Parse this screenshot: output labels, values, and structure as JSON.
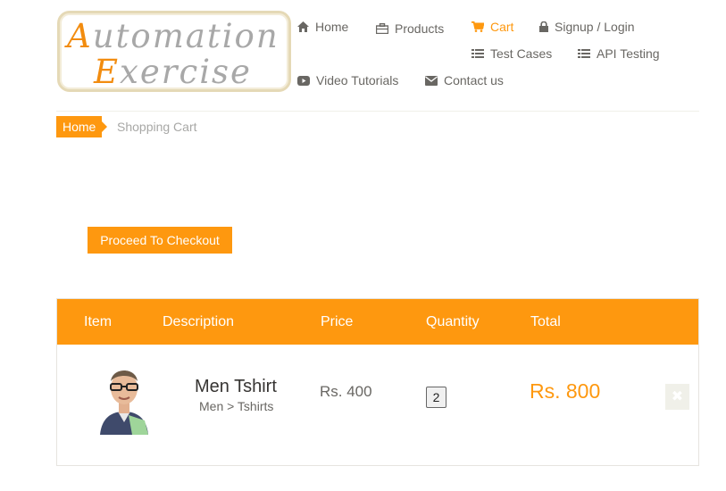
{
  "logo": {
    "line1_cap": "A",
    "line1_rest": "utomation",
    "line2_cap": "E",
    "line2_rest": "xercise"
  },
  "nav": {
    "home": "Home",
    "products": "Products",
    "cart": "Cart",
    "signup_login": "Signup / Login",
    "test_cases": "Test Cases",
    "api_testing": "API Testing",
    "video_tutorials": "Video Tutorials",
    "contact_us": "Contact us"
  },
  "breadcrumb": {
    "home": "Home",
    "current": "Shopping Cart"
  },
  "checkout_button": "Proceed To Checkout",
  "table": {
    "headers": {
      "item": "Item",
      "description": "Description",
      "price": "Price",
      "quantity": "Quantity",
      "total": "Total"
    },
    "rows": [
      {
        "name": "Men Tshirt",
        "category": "Men > Tshirts",
        "price": "Rs. 400",
        "quantity": "2",
        "total": "Rs. 800",
        "delete_icon": "times-icon"
      }
    ]
  },
  "colors": {
    "accent": "#fe980f",
    "text": "#696763",
    "muted": "#a8a8a6"
  }
}
